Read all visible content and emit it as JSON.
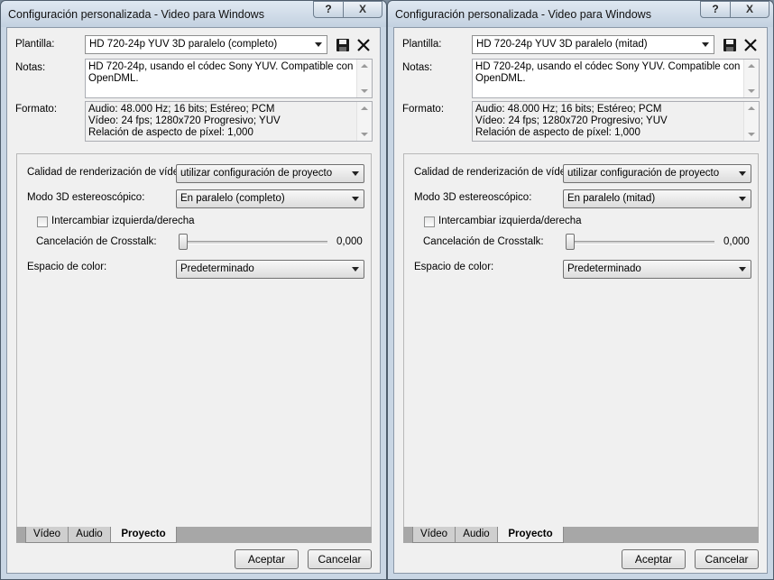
{
  "windows": [
    {
      "title": "Configuración personalizada - Video para Windows",
      "help_label": "?",
      "close_label": "X",
      "plantilla_label": "Plantilla:",
      "plantilla_value": "HD 720-24p YUV 3D paralelo (completo)",
      "notas_label": "Notas:",
      "notas_value": "HD 720-24p, usando el códec Sony YUV. Compatible con OpenDML.",
      "formato_label": "Formato:",
      "formato_lines": [
        "Audio: 48.000 Hz; 16 bits; Estéreo; PCM",
        "Vídeo: 24 fps; 1280x720 Progresivo; YUV",
        "Relación de aspecto de píxel: 1,000"
      ],
      "calidad_label": "Calidad de renderización de vídeo:",
      "calidad_value": "utilizar configuración de proyecto",
      "modo3d_label": "Modo 3D estereoscópico:",
      "modo3d_value": "En paralelo (completo)",
      "intercambiar_label": "Intercambiar izquierda/derecha",
      "intercambiar_checked": false,
      "crosstalk_label": "Cancelación de Crosstalk:",
      "crosstalk_value": "0,000",
      "espacio_label": "Espacio de color:",
      "espacio_value": "Predeterminado",
      "tabs": [
        "Vídeo",
        "Audio",
        "Proyecto"
      ],
      "active_tab": "Proyecto",
      "ok_label": "Aceptar",
      "cancel_label": "Cancelar"
    },
    {
      "title": "Configuración personalizada - Video para Windows",
      "help_label": "?",
      "close_label": "X",
      "plantilla_label": "Plantilla:",
      "plantilla_value": "HD 720-24p YUV 3D paralelo (mitad)",
      "notas_label": "Notas:",
      "notas_value": "HD 720-24p, usando el códec Sony YUV. Compatible con OpenDML.",
      "formato_label": "Formato:",
      "formato_lines": [
        "Audio: 48.000 Hz; 16 bits; Estéreo; PCM",
        "Vídeo: 24 fps; 1280x720 Progresivo; YUV",
        "Relación de aspecto de píxel: 1,000"
      ],
      "calidad_label": "Calidad de renderización de vídeo:",
      "calidad_value": "utilizar configuración de proyecto",
      "modo3d_label": "Modo 3D estereoscópico:",
      "modo3d_value": "En paralelo (mitad)",
      "intercambiar_label": "Intercambiar izquierda/derecha",
      "intercambiar_checked": false,
      "crosstalk_label": "Cancelación de Crosstalk:",
      "crosstalk_value": "0,000",
      "espacio_label": "Espacio de color:",
      "espacio_value": "Predeterminado",
      "tabs": [
        "Vídeo",
        "Audio",
        "Proyecto"
      ],
      "active_tab": "Proyecto",
      "ok_label": "Aceptar",
      "cancel_label": "Cancelar"
    }
  ],
  "icons": {
    "save": "floppy-disk-icon",
    "delete": "delete-x-icon"
  }
}
